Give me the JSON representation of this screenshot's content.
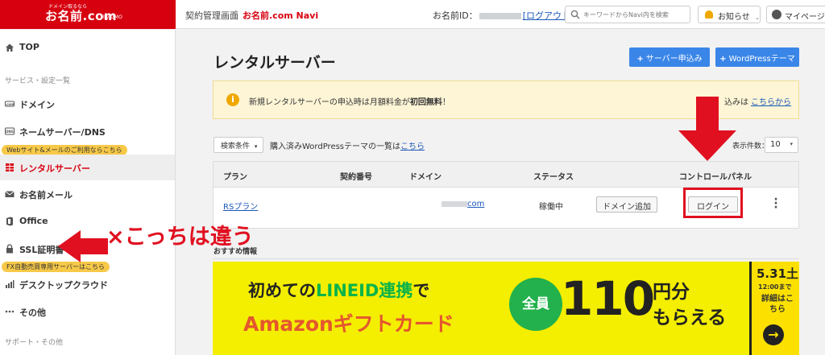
{
  "header": {
    "logo_small": "ドメイン取るなら",
    "logo_main": "お名前.com",
    "logo_sub": "by GMO",
    "nav_link": "契約管理画面",
    "nav_separator": "|",
    "nav_brand": "お名前.com Navi",
    "member_label": "お名前ID：",
    "logout": "[ログアウト]",
    "search_placeholder": "キーワードからNavi内を検索",
    "notice": "お知らせ",
    "mypage": "マイページ"
  },
  "sidebar": {
    "top": "TOP",
    "section_service": "サービス・設定一覧",
    "domain": "ドメイン",
    "nameserver": "ネームサーバー/DNS",
    "tag_web": "Webサイト&メールのご利用ならこちら",
    "rental": "レンタルサーバー",
    "mail": "お名前メール",
    "office": "Office",
    "ssl": "SSL証明書",
    "tag_fx": "FX自動売買専用サーバーはこちら",
    "desktop": "デスクトップクラウド",
    "other": "その他",
    "section_support": "サポート・その他"
  },
  "main": {
    "title": "レンタルサーバー",
    "btn_server_apply": "サーバー申込み",
    "btn_wordpress": "WordPressテーマ",
    "banner_text": "新規レンタルサーバーの申込時は月額料金が",
    "banner_bold": "初回無料",
    "banner_end": "！",
    "banner_right": "込みは",
    "banner_right_link": "こちらから",
    "filter": "検索条件",
    "filter_text": "購入済みWordPressテーマの一覧は",
    "filter_link": "こちら",
    "count_label": "表示件数：",
    "count_value": "10"
  },
  "table": {
    "headers": [
      "プラン",
      "契約番号",
      "ドメイン",
      "ステータス",
      "コントロールパネル"
    ],
    "row": {
      "plan": "RSプラン",
      "domain_suffix": "com",
      "status": "稼働中",
      "add_domain": "ドメイン追加",
      "login": "ログイン"
    }
  },
  "recommend": {
    "label": "おすすめ情報"
  },
  "ad": {
    "line1_pre": "初めての",
    "line1_green": "LINEID連携",
    "line1_post": "で",
    "line2": "Amazonギフトカード",
    "badge": "全員",
    "big_number": "110",
    "unit1": "円分",
    "unit2": "もらえる",
    "date": "5.31土",
    "time": "12:00まで",
    "detail": "詳細はこちら",
    "arrow": "→"
  },
  "annotation": {
    "wrong_text": "×こっちは違う"
  },
  "colors": {
    "brand_red": "#d7000f",
    "primary_blue": "#3a86e8",
    "annotation_red": "#e01020",
    "ad_yellow": "#f4ee00"
  }
}
